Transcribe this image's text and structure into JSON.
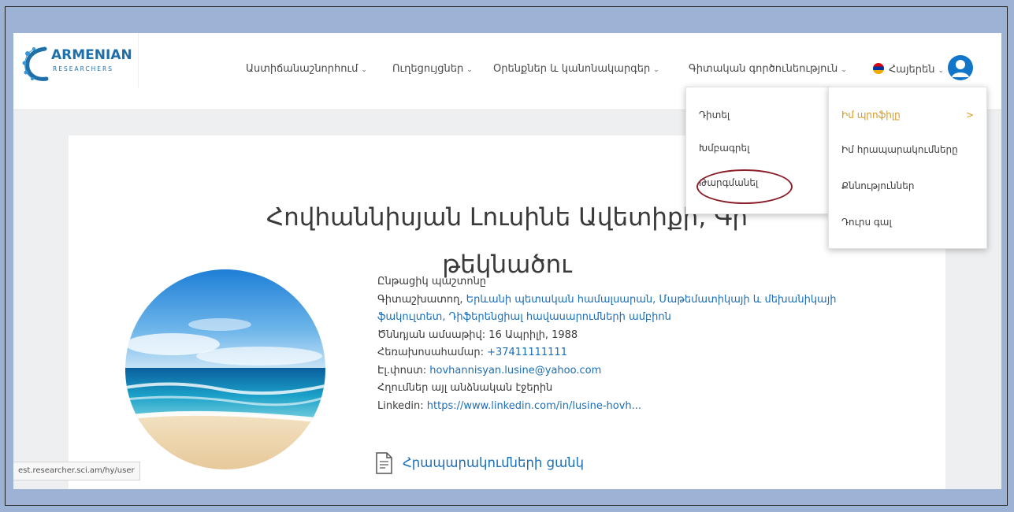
{
  "logo": {
    "main": "ARMENIAN",
    "sub": "RESEARCHERS"
  },
  "nav": {
    "items": [
      {
        "label": "Աստիճանաշնորհում"
      },
      {
        "label": "Ուղեցույցներ"
      },
      {
        "label": "Օրենքներ և կանոնակարգեր"
      },
      {
        "label": "Գիտական գործունեություն"
      }
    ],
    "language": "Հայերեն",
    "caret": "⌄"
  },
  "dropdown_primary": {
    "items": [
      "Դիտել",
      "Խմբագրել",
      "Թարգմանել"
    ]
  },
  "dropdown_secondary": {
    "items": [
      "Իմ պրոֆիլը",
      "Իմ հրապարակումները",
      "Քննություններ",
      "Դուրս գալ"
    ],
    "arrow": ">"
  },
  "profile": {
    "name_line1": "Հովհաննիսյան Լուսինե Ավետիքի, Գի",
    "name_line2": "թեկնածու",
    "position_label": "Ընթացիկ պաշտոնը",
    "position_value_line1": "Գիտաշխատող, Երևանի պետական համալսարան, Մաթեմատիկայի և մեխանիկայի",
    "position_value_line2": "ֆակուլտետ, Դիֆերենցիալ հավասարումների ամբիոն",
    "birth_label": "Ծննդյան ամսաթիվ:",
    "birth_value": "16 Ապրիլի, 1988",
    "phone_label": "Հեռախոսահամար:",
    "phone_value": "+37411111111",
    "email_label": "Էլ.փոստ:",
    "email_value": "hovhannisyan.lusine@yahoo.com",
    "links_label": "Հղումներ այլ անձնական էջերին",
    "linkedin_label": "Linkedin:",
    "linkedin_value": "https://www.linkedin.com/in/lusine-hovh..."
  },
  "publications_label": "Հրապարակումների ցանկ",
  "status_url": "est.researcher.sci.am/hy/user",
  "colors": {
    "accent": "#1176c8",
    "active": "#d99a1d",
    "annotation": "#8b1f2a",
    "background": "#9db3d6"
  },
  "icons": [
    "logo-mark",
    "caret-down-icon",
    "flag-icon",
    "user-icon",
    "document-icon",
    "chevron-right-icon"
  ]
}
